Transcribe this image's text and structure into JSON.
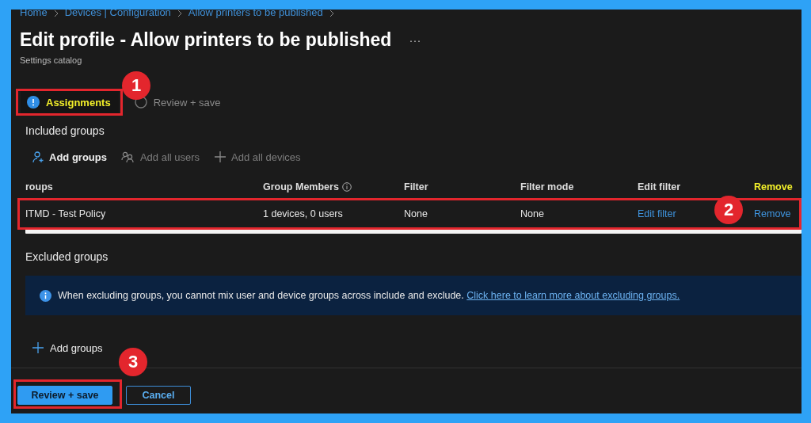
{
  "breadcrumb": [
    "Home",
    "Devices | Configuration",
    "Allow printers to be published"
  ],
  "title": "Edit profile - Allow printers to be published",
  "more": "···",
  "subtitle": "Settings catalog",
  "steps": [
    {
      "label": "Assignments",
      "selected": true
    },
    {
      "label": "Review + save",
      "selected": false
    }
  ],
  "included": {
    "heading": "Included groups",
    "actions": [
      {
        "label": "Add groups",
        "disabled": false,
        "kind": "person"
      },
      {
        "label": "Add all users",
        "disabled": true,
        "kind": "people"
      },
      {
        "label": "Add all devices",
        "disabled": true,
        "kind": "plus"
      }
    ]
  },
  "table": {
    "columns": [
      "roups",
      "Group Members",
      "Filter",
      "Filter mode",
      "Edit filter",
      "Remove"
    ],
    "rows": [
      {
        "group": "ITMD - Test Policy",
        "members": "1 devices, 0 users",
        "filter": "None",
        "filter_mode": "None",
        "edit_filter": "Edit filter",
        "remove": "Remove"
      }
    ]
  },
  "excluded": {
    "heading": "Excluded groups",
    "info": "When excluding groups, you cannot mix user and device groups across include and exclude.",
    "link": "Click here to learn more about excluding groups.",
    "add": "Add groups"
  },
  "footer": {
    "buttons": [
      {
        "label": "Review + save",
        "kind": "primary"
      },
      {
        "label": "Cancel",
        "kind": "secondary"
      }
    ]
  },
  "annotations": [
    {
      "number": "1"
    },
    {
      "number": "2"
    },
    {
      "number": "3"
    }
  ]
}
